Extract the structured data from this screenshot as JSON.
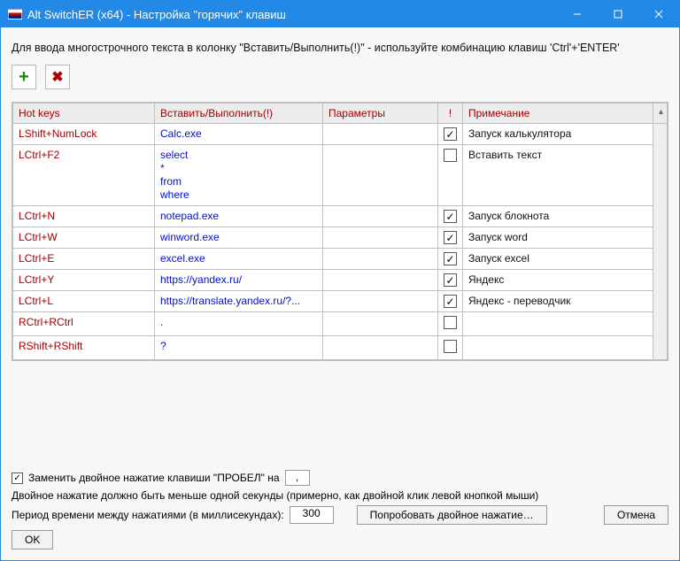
{
  "window": {
    "title": "Alt SwitchER (x64) - Настройка \"горячих\" клавиш"
  },
  "instruction": "Для ввода многострочного текста в колонку \"Вставить/Выполнить(!)\" - используйте комбинацию клавиш 'Ctrl'+'ENTER'",
  "toolbar": {
    "add_symbol": "＋",
    "del_symbol": "✖"
  },
  "grid": {
    "headers": {
      "hotkeys": "Hot keys",
      "insert": "Вставить/Выполнить(!)",
      "params": "Параметры",
      "bang": "!",
      "note": "Примечание"
    },
    "rows": [
      {
        "hotkey": "LShift+NumLock",
        "insert": "Calc.exe",
        "params": "",
        "bang": true,
        "note": "Запуск калькулятора"
      },
      {
        "hotkey": "LCtrl+F2",
        "insert": "select\n*\nfrom\nwhere",
        "params": "",
        "bang": false,
        "note": "Вставить текст"
      },
      {
        "hotkey": "LCtrl+N",
        "insert": "notepad.exe",
        "params": "",
        "bang": true,
        "note": "Запуск блокнота"
      },
      {
        "hotkey": "LCtrl+W",
        "insert": "winword.exe",
        "params": "",
        "bang": true,
        "note": "Запуск word"
      },
      {
        "hotkey": "LCtrl+E",
        "insert": "excel.exe",
        "params": "",
        "bang": true,
        "note": "Запуск excel"
      },
      {
        "hotkey": "LCtrl+Y",
        "insert": "https://yandex.ru/",
        "params": "",
        "bang": true,
        "note": "Яндекс"
      },
      {
        "hotkey": "LCtrl+L",
        "insert": "https://translate.yandex.ru/?...",
        "params": "",
        "bang": true,
        "note": "Яндекс - переводчик"
      },
      {
        "hotkey": "RCtrl+RCtrl",
        "insert": ".",
        "params": "",
        "bang": false,
        "note": ""
      },
      {
        "hotkey": "RShift+RShift",
        "insert": "?",
        "params": "",
        "bang": false,
        "note": ""
      }
    ]
  },
  "bottom": {
    "replace_checked": true,
    "replace_label_prefix": "Заменить двойное нажатие клавиши \"ПРОБЕЛ\" на",
    "replace_value": ",",
    "double_note": "Двойное нажатие должно быть меньше одной секунды (примерно, как двойной клик левой кнопкой мыши)",
    "period_label": "Период времени между нажатиями (в миллисекундах):",
    "period_value": "300",
    "try_label": "Попробовать двойное нажатие…",
    "cancel_label": "Отмена",
    "ok_label": "OK"
  }
}
